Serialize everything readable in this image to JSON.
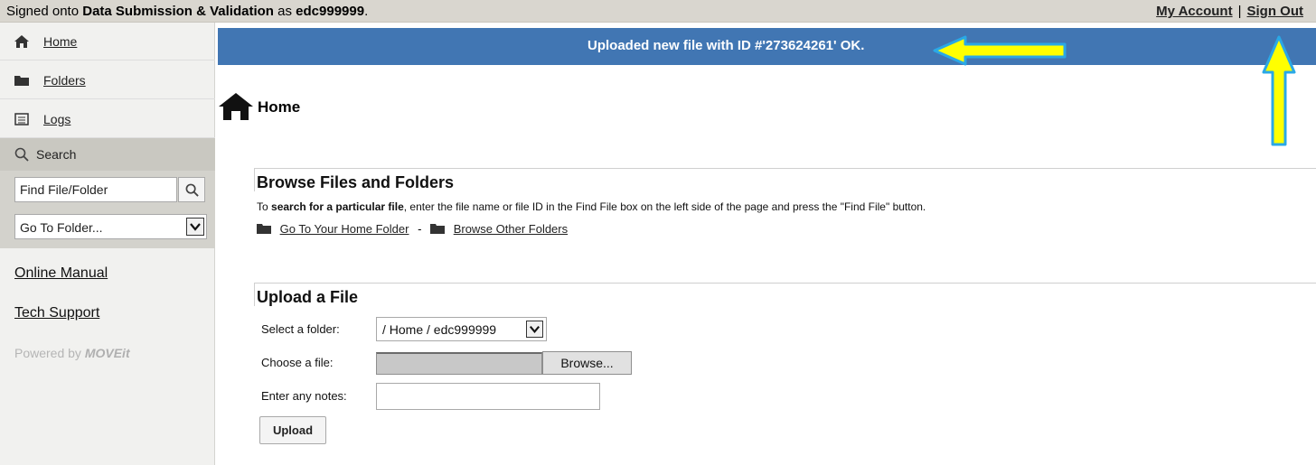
{
  "topbar": {
    "signed_prefix": "Signed onto ",
    "app_name": "Data Submission & Validation",
    "as_text": " as ",
    "username": "edc999999",
    "period": ".",
    "my_account": "My Account",
    "separator": "|",
    "sign_out": "Sign Out"
  },
  "sidebar": {
    "items": [
      {
        "label": "Home",
        "icon": "home-icon"
      },
      {
        "label": "Folders",
        "icon": "folder-icon"
      },
      {
        "label": "Logs",
        "icon": "logs-icon"
      }
    ],
    "search_label": "Search",
    "find_placeholder": "Find File/Folder",
    "goto_value": "Go To Folder...",
    "online_manual": "Online Manual",
    "tech_support": "Tech Support",
    "powered_by": "Powered by ",
    "powered_brand": "MOVEit"
  },
  "banner": {
    "message": "Uploaded new file with ID #'273624261' OK."
  },
  "main": {
    "title": "Home",
    "browse": {
      "title": "Browse Files and Folders",
      "desc_prefix": "To ",
      "desc_bold": "search for a particular file",
      "desc_suffix": ", enter the file name or file ID in the Find File box on the left side of the page and press the \"Find File\" button.",
      "home_folder_link": "Go To Your Home Folder",
      "dash": "-",
      "other_folders_link": "Browse Other Folders"
    },
    "upload": {
      "title": "Upload a File",
      "select_folder_label": "Select a folder:",
      "folder_value": "/ Home / edc999999",
      "choose_file_label": "Choose a file:",
      "browse_button": "Browse...",
      "notes_label": "Enter any notes:",
      "notes_value": "",
      "upload_button": "Upload"
    }
  },
  "colors": {
    "banner": "#4176b3",
    "arrow_fill": "#ffff00",
    "arrow_outline": "#2aa8e6"
  }
}
